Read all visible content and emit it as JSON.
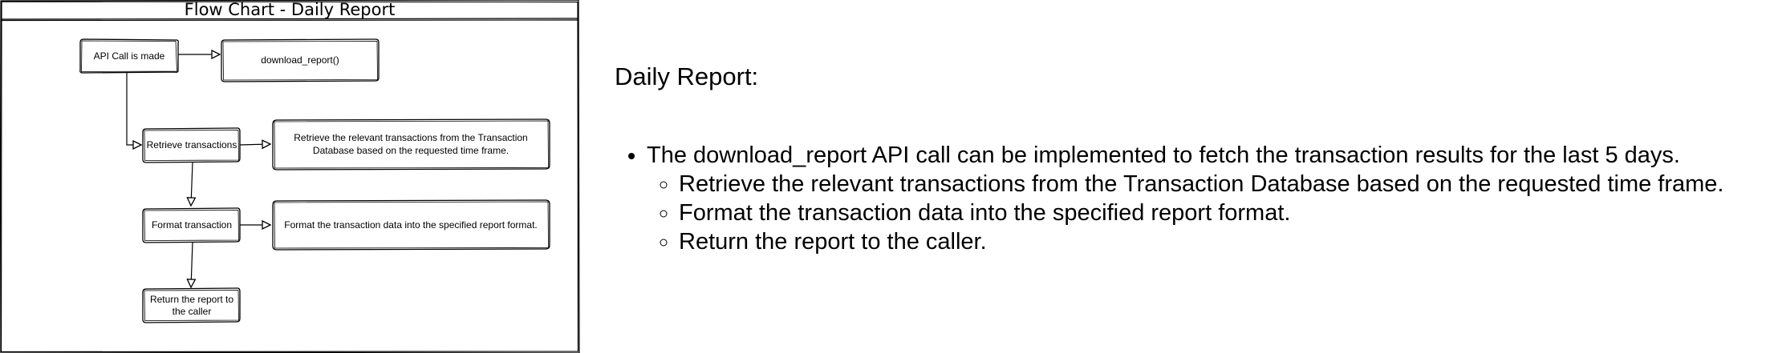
{
  "diagram": {
    "title": "Flow Chart - Daily Report",
    "nodes": {
      "api_call": "API Call is made",
      "download_report": "download_report()",
      "retrieve": "Retrieve transactions",
      "retrieve_desc_line1": "Retrieve the relevant transactions from the Transaction",
      "retrieve_desc_line2": "Database based on the requested time frame.",
      "format": "Format transaction",
      "format_desc": "Format the transaction data into the specified report format.",
      "return_line1": "Return the report to",
      "return_line2": "the caller"
    },
    "edges": [
      {
        "from": "api_call",
        "to": "download_report"
      },
      {
        "from": "api_call",
        "to": "retrieve"
      },
      {
        "from": "retrieve",
        "to": "retrieve_desc"
      },
      {
        "from": "retrieve",
        "to": "format"
      },
      {
        "from": "format",
        "to": "format_desc"
      },
      {
        "from": "format",
        "to": "return"
      }
    ]
  },
  "notes": {
    "heading": "Daily Report:",
    "main_item": "The download_report API call can be implemented to fetch the transaction results for the last 5 days.",
    "sub_items": [
      "Retrieve the relevant transactions from the Transaction Database based on the requested time frame.",
      "Format the transaction data into the specified report format.",
      "Return the report to the caller."
    ]
  }
}
